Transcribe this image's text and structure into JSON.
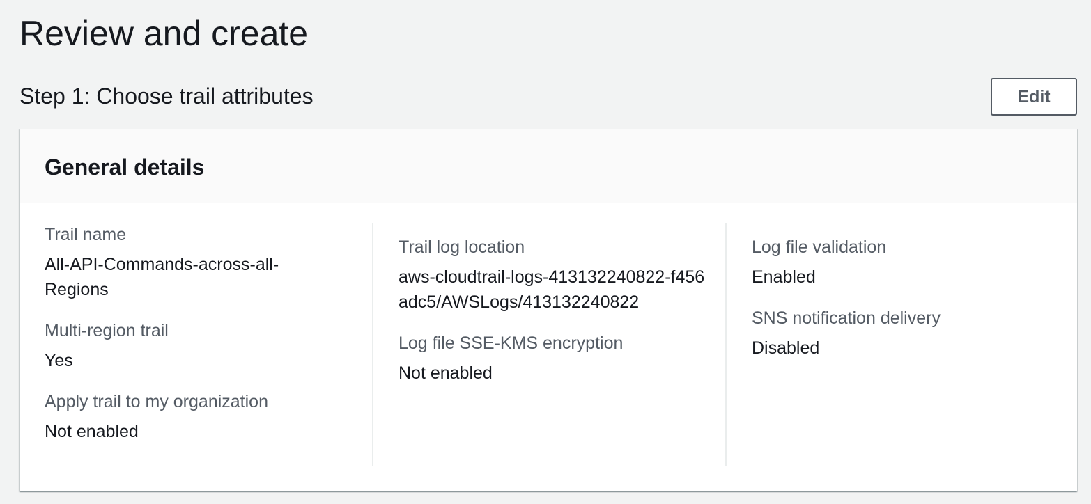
{
  "page": {
    "title": "Review and create"
  },
  "step": {
    "title": "Step 1: Choose trail attributes",
    "edit_label": "Edit"
  },
  "panel": {
    "title": "General details",
    "columns": [
      {
        "items": [
          {
            "label": "Trail name",
            "value": "All-API-Commands-across-all-Regions"
          },
          {
            "label": "Multi-region trail",
            "value": "Yes"
          },
          {
            "label": "Apply trail to my organization",
            "value": "Not enabled"
          }
        ]
      },
      {
        "items": [
          {
            "label": "Trail log location",
            "value": "aws-cloudtrail-logs-413132240822-f456adc5/AWSLogs/413132240822"
          },
          {
            "label": "Log file SSE-KMS encryption",
            "value": "Not enabled"
          }
        ]
      },
      {
        "items": [
          {
            "label": "Log file validation",
            "value": "Enabled"
          },
          {
            "label": "SNS notification delivery",
            "value": "Disabled"
          }
        ]
      }
    ]
  },
  "colors": {
    "background": "#f2f3f3",
    "text": "#16191f",
    "label": "#545b64",
    "panel_header": "#fafafa",
    "divider": "#eaeded"
  }
}
